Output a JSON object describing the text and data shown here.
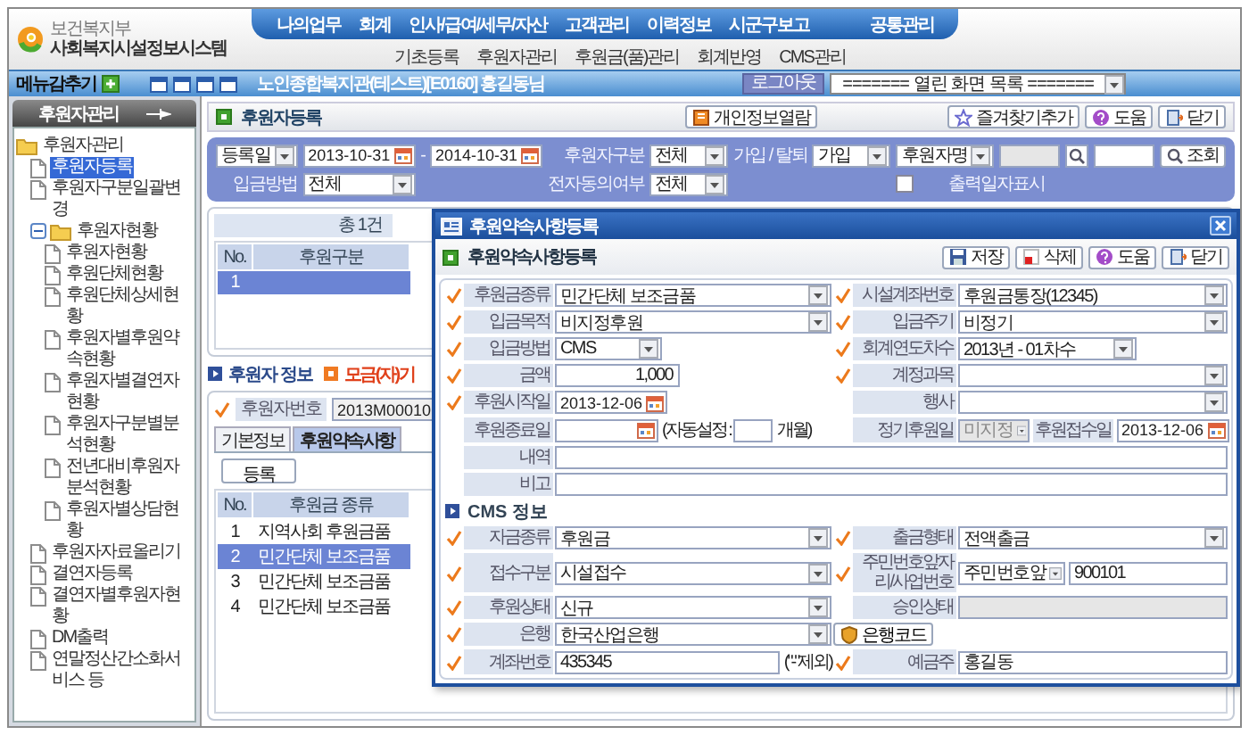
{
  "header": {
    "ministry": "보건복지부",
    "system": "사회복지시설정보시스템",
    "menu": [
      "나의업무",
      "회계",
      "인사/급여/세무/자산",
      "고객관리",
      "이력정보",
      "시군구보고",
      "공통관리"
    ],
    "submenu": [
      "기초등록",
      "후원자관리",
      "후원금(품)관리",
      "회계반영",
      "CMS관리"
    ]
  },
  "toolbar": {
    "hide_menu": "메뉴감추기",
    "session": "노인종합복지관(테스트)[E0160] 홍길동님",
    "logout": "로그아웃",
    "open_screens": "======= 열린 화면 목록 ======="
  },
  "sidebar": {
    "title": "후원자관리",
    "tree": [
      {
        "label": "후원자관리",
        "kind": "root",
        "selected": false,
        "children": [
          {
            "label": "후원자등록",
            "kind": "page",
            "selected": true
          },
          {
            "label": "후원자구분일괄변경",
            "kind": "page",
            "selected": false
          },
          {
            "label": "후원자현황",
            "kind": "folder",
            "selected": false,
            "expanded": true,
            "children": [
              {
                "label": "후원자현황",
                "kind": "page",
                "selected": false
              },
              {
                "label": "후원단체현황",
                "kind": "page",
                "selected": false
              },
              {
                "label": "후원단체상세현황",
                "kind": "page",
                "selected": false
              },
              {
                "label": "후원자별후원약속현황",
                "kind": "page",
                "selected": false
              },
              {
                "label": "후원자별결연자현황",
                "kind": "page",
                "selected": false
              },
              {
                "label": "후원자구분별분석현황",
                "kind": "page",
                "selected": false
              },
              {
                "label": "전년대비후원자분석현황",
                "kind": "page",
                "selected": false
              },
              {
                "label": "후원자별상담현황",
                "kind": "page",
                "selected": false
              }
            ]
          },
          {
            "label": "후원자자료올리기",
            "kind": "page",
            "selected": false
          },
          {
            "label": "결연자등록",
            "kind": "page",
            "selected": false
          },
          {
            "label": "결연자별후원자현황",
            "kind": "page",
            "selected": false
          },
          {
            "label": "DM출력",
            "kind": "page",
            "selected": false
          },
          {
            "label": "연말정산간소화서비스 등",
            "kind": "page",
            "selected": false
          }
        ]
      }
    ]
  },
  "page": {
    "title": "후원자등록",
    "buttons": [
      {
        "label": "개인정보열람",
        "kind": "book"
      },
      {
        "label": "즐겨찾기추가",
        "kind": "star"
      },
      {
        "label": "도움",
        "kind": "help"
      },
      {
        "label": "닫기",
        "kind": "close"
      }
    ]
  },
  "search": {
    "rows": [
      [
        {
          "kind": "select",
          "value": "등록일"
        },
        {
          "kind": "date",
          "value": "2013-10-31"
        },
        {
          "kind": "label",
          "text": "-"
        },
        {
          "kind": "date",
          "value": "2014-10-31"
        },
        {
          "kind": "label",
          "text": "후원자구분"
        },
        {
          "kind": "select",
          "value": "전체"
        },
        {
          "kind": "label",
          "text": "가입 / 탈퇴"
        },
        {
          "kind": "select",
          "value": "가입"
        },
        {
          "kind": "select",
          "value": "후원자명"
        },
        {
          "kind": "locked-text"
        },
        {
          "kind": "search-button"
        },
        {
          "kind": "text"
        },
        {
          "kind": "button",
          "label": "조회"
        }
      ],
      [
        {
          "kind": "label",
          "text": "입금방법"
        },
        {
          "kind": "select",
          "value": "전체"
        },
        "",
        "",
        {
          "kind": "label",
          "text": "전자동의여부"
        },
        {
          "kind": "select",
          "value": "전체"
        },
        "",
        "",
        {
          "kind": "checkbox",
          "label": "출력일자표시",
          "checked": false
        }
      ]
    ]
  },
  "donor_list": {
    "count": "총 1건",
    "columns": [
      "No.",
      "후원구분"
    ],
    "rows": [
      {
        "no": "1",
        "selected": true
      }
    ]
  },
  "donor_info": {
    "title": "후원자 정보",
    "notice": "모금(자)기",
    "number": {
      "label": "후원자번호",
      "value": "2013M00010",
      "required": true
    },
    "tabs": [
      {
        "label": "기본정보",
        "selected": false
      },
      {
        "label": "후원약속사항",
        "selected": true
      }
    ],
    "add_button": "등록",
    "columns": [
      "No.",
      "후원금 종류"
    ],
    "rows": [
      {
        "no": "1",
        "type": "지역사회 후원금품",
        "selected": false
      },
      {
        "no": "2",
        "type": "민간단체 보조금품",
        "selected": true
      },
      {
        "no": "3",
        "type": "민간단체 보조금품",
        "selected": false
      },
      {
        "no": "4",
        "type": "민간단체 보조금품",
        "selected": false
      }
    ]
  },
  "dialog": {
    "title": "후원약속사항등록",
    "heading": "후원약속사항등록",
    "buttons": [
      {
        "label": "저장",
        "kind": "save"
      },
      {
        "label": "삭제",
        "kind": "delete"
      },
      {
        "label": "도움",
        "kind": "help"
      },
      {
        "label": "닫기",
        "kind": "close"
      }
    ],
    "rows": [
      {
        "left": {
          "label": "후원금종류",
          "required": true,
          "controls": [
            {
              "kind": "select",
              "value": "민간단체 보조금품"
            }
          ]
        },
        "right": {
          "label": "시설계좌번호",
          "required": true,
          "controls": [
            {
              "kind": "select",
              "value": "후원금통장(12345)"
            }
          ]
        }
      },
      {
        "left": {
          "label": "입금목적",
          "required": true,
          "controls": [
            {
              "kind": "select",
              "value": "비지정후원"
            }
          ]
        },
        "right": {
          "label": "입금주기",
          "required": true,
          "controls": [
            {
              "kind": "select",
              "value": "비정기"
            }
          ]
        }
      },
      {
        "left": {
          "label": "입금방법",
          "required": true,
          "controls": [
            {
              "kind": "short-select",
              "value": "CMS"
            }
          ]
        },
        "right": {
          "label": "회계연도차수",
          "required": true,
          "controls": [
            {
              "kind": "mid-select",
              "value": "2013년 - 01차수"
            }
          ]
        }
      },
      {
        "left": {
          "label": "금액",
          "required": true,
          "controls": [
            {
              "kind": "amount",
              "value": "1,000"
            }
          ]
        },
        "right": {
          "label": "계정과목",
          "required": true,
          "controls": [
            {
              "kind": "select"
            }
          ]
        }
      },
      {
        "left": {
          "label": "후원시작일",
          "required": true,
          "controls": [
            {
              "kind": "date",
              "value": "2013-12-06"
            }
          ]
        },
        "right": {
          "label": "행사",
          "required": false,
          "controls": [
            {
              "kind": "select"
            }
          ]
        }
      },
      {
        "left": {
          "label": "후원종료일",
          "required": false,
          "controls": [
            {
              "kind": "date"
            },
            {
              "kind": "note",
              "text": "(자동설정 :"
            },
            {
              "kind": "small-text"
            },
            {
              "kind": "note",
              "text": "개월)"
            }
          ]
        },
        "right": {
          "label": "정기후원일",
          "required": false,
          "controls": [
            {
              "kind": "locked-select",
              "value": "미지정"
            },
            {
              "kind": "inline-label",
              "text": "후원접수일"
            },
            {
              "kind": "date",
              "value": "2013-12-06"
            }
          ]
        }
      },
      {
        "full": {
          "label": "내역",
          "required": false,
          "controls": [
            {
              "kind": "text"
            }
          ]
        }
      },
      {
        "full": {
          "label": "비고",
          "required": false,
          "controls": [
            {
              "kind": "text"
            }
          ]
        }
      }
    ],
    "cms_title": "CMS 정보",
    "cms_rows": [
      {
        "left": {
          "label": "자금종류",
          "required": true,
          "controls": [
            {
              "kind": "select",
              "value": "후원금"
            }
          ]
        },
        "right": {
          "label": "출금형태",
          "required": true,
          "controls": [
            {
              "kind": "select",
              "value": "전액출금"
            }
          ]
        }
      },
      {
        "left": {
          "label": "접수구분",
          "required": true,
          "controls": [
            {
              "kind": "select",
              "value": "시설접수"
            }
          ]
        },
        "right": {
          "label": "주민번호앞자리/사업번호",
          "required": true,
          "controls": [
            {
              "kind": "short-select",
              "value": "주민번호앞"
            },
            {
              "kind": "text",
              "value": "900101"
            }
          ]
        }
      },
      {
        "left": {
          "label": "후원상태",
          "required": true,
          "controls": [
            {
              "kind": "select",
              "value": "신규"
            }
          ]
        },
        "right": {
          "label": "승인상태",
          "required": false,
          "controls": [
            {
              "kind": "locked-text"
            }
          ]
        }
      },
      {
        "left": {
          "label": "은행",
          "required": true,
          "controls": [
            {
              "kind": "select",
              "value": "한국산업은행"
            }
          ]
        },
        "right": {
          "controls": [
            {
              "kind": "button",
              "label": "은행코드"
            }
          ]
        }
      },
      {
        "left": {
          "label": "계좌번호",
          "required": true,
          "controls": [
            {
              "kind": "text",
              "value": "435345"
            },
            {
              "kind": "note",
              "text": "(\"-\"제외)"
            }
          ]
        },
        "right": {
          "label": "예금주",
          "required": true,
          "controls": [
            {
              "kind": "text",
              "value": "홍길동"
            }
          ]
        }
      }
    ]
  }
}
